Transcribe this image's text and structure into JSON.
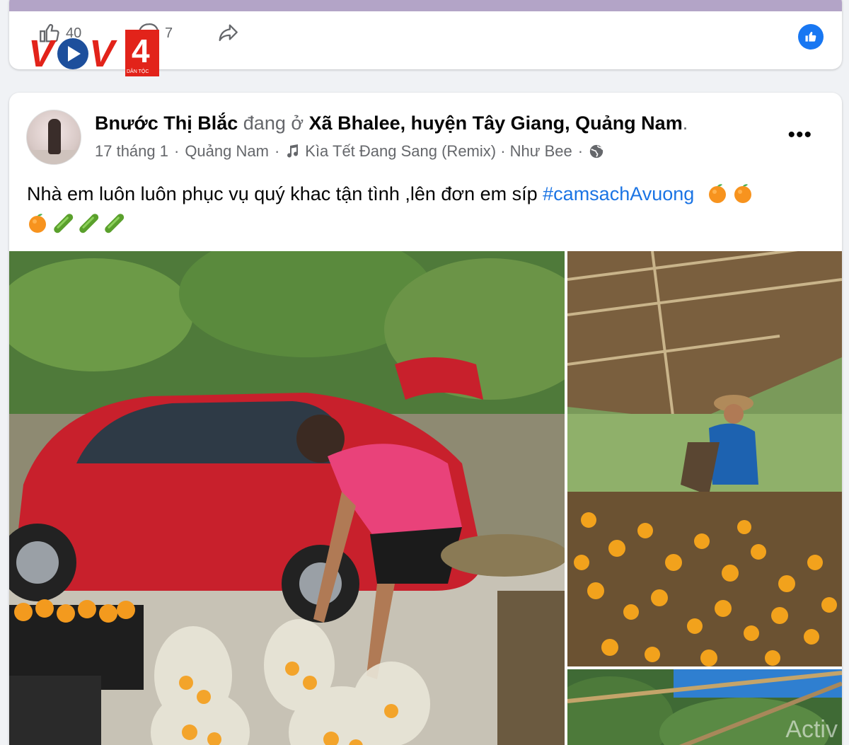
{
  "top_post": {
    "like_count": "40",
    "comment_count": "7",
    "like_icon": "thumb-up-icon",
    "comment_icon": "comment-bubble-icon",
    "share_icon": "share-arrow-icon"
  },
  "logo": {
    "text": "VOV",
    "number": "4",
    "sub": "DÂN TỘC",
    "colors": {
      "red": "#e2231a",
      "blue": "#1d4f9c"
    }
  },
  "post": {
    "author": "Bnước Thị Blắc",
    "at_text": " đang ở ",
    "place": "Xã Bhalee, huyện Tây Giang, Quảng Nam",
    "period": ".",
    "date": "17 tháng 1",
    "sep": "·",
    "location": "Quảng Nam",
    "music": "Kìa Tết Đang Sang (Remix) · Như Bee",
    "privacy_icon": "globe-icon",
    "more_label": "•••",
    "text_before": "Nhà em luôn luôn phục vụ quý khac tận tình ,lên đơn em síp ",
    "hashtag": "#camsachAvuong",
    "emojis": [
      "tangerine",
      "tangerine",
      "tangerine",
      "cucumber",
      "cucumber",
      "cucumber"
    ]
  },
  "photos": {
    "photo1": "Man packing oranges beside red car",
    "photo2": "Woman sorting oranges under thatched roof",
    "photo3": "Orchard scene",
    "watermark": "Activ"
  },
  "colors": {
    "link": "#1b74e4",
    "secondary_text": "#65676b",
    "like_blue": "#1877f2"
  }
}
